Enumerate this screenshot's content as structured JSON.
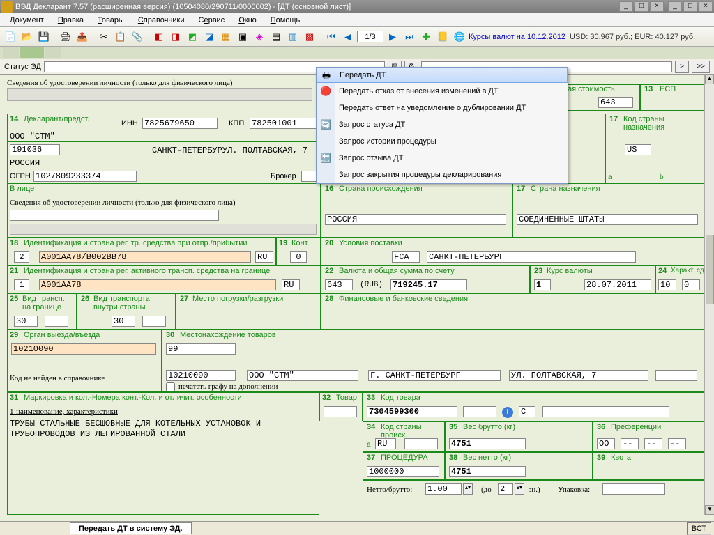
{
  "title": "ВЭД Декларант 7.57 (расширенная версия) (10504080/290711/0000002) - [ДТ (основной лист)]",
  "menubar": [
    "Документ",
    "Правка",
    "Товары",
    "Справочники",
    "Сервис",
    "Окно",
    "Помощь"
  ],
  "toolbar": {
    "page": "1/3",
    "rates_link": "Курсы валют на 10.12.2012",
    "rates": "USD: 30.967 руб.; EUR: 40.127 руб."
  },
  "status_label": "Статус ЭД",
  "context_menu": [
    "Передать ДТ",
    "Передать отказ от внесения изменений в ДТ",
    "Передать ответ на уведомление о дублировании ДТ",
    "Запрос статуса ДТ",
    "Запрос истории процедуры",
    "Запрос отзыва ДТ",
    "Запрос закрытия процедуры декларирования"
  ],
  "f": {
    "top_cut": "Сведения об удостоверении личности (только для физического лица)",
    "box_cost": "ая стоимость",
    "b13": "13",
    "b13_l": "ЕСП",
    "b13_v": "643",
    "b14": "14",
    "b14_l": "Декларант/предст.",
    "inn_l": "ИНН",
    "inn_v": "7825679650",
    "kpp_l": "КПП",
    "kpp_v": "782501001",
    "b17": "17",
    "b17_l": "Код страны назначения",
    "b17_v": "US",
    "company": "ООО \"СТМ\"",
    "zip": "191036",
    "addr": "САНКТ-ПЕТЕРБУРУЛ. ПОЛТАВСКАЯ, 7",
    "country": "РОССИЯ",
    "ogrn_l": "ОГРН",
    "ogrn_v": "1027809233374",
    "broker_l": "Брокер",
    "vlice": "В лице",
    "id_note": "Сведения об удостоверении личности (только для физического лица)",
    "b16": "16",
    "b16_l": "Страна происхождения",
    "b16_v": "РОССИЯ",
    "b17a": "17",
    "b17a_l": "Страна назначения",
    "b17a_v": "СОЕДИНЕННЫЕ ШТАТЫ",
    "sml_a": "а",
    "sml_b": "b",
    "b18": "18",
    "b18_l": "Идентификация и страна рег. тр. средства при отпр./прибытии",
    "b18_n": "2",
    "b18_id": "A001AA78/B002BB78",
    "b18_c": "RU",
    "b19": "19",
    "b19_l": "Конт.",
    "b19_v": "0",
    "b20": "20",
    "b20_l": "Условия поставки",
    "b20_c": "FCA",
    "b20_v": "САНКТ-ПЕТЕРБУРГ",
    "b21": "21",
    "b21_l": "Идентификация и страна рег. активного трансп. средства на границе",
    "b21_n": "1",
    "b21_id": "A001AA78",
    "b21_c": "RU",
    "b22": "22",
    "b22_l": "Валюта и общая сумма по счету",
    "b22_c": "643",
    "b22_cur": "(RUB)",
    "b22_v": "719245.17",
    "b23": "23",
    "b23_l": "Курс валюты",
    "b23_v": "1",
    "b23_d": "28.07.2011",
    "b24": "24",
    "b24_l": "Характ. сд.",
    "b24_a": "10",
    "b24_b": "0",
    "b25": "25",
    "b25_l": "Вид трансп. на границе",
    "b25_v": "30",
    "b26": "26",
    "b26_l": "Вид транспорта внутри страны",
    "b26_v": "30",
    "b27": "27",
    "b27_l": "Место погрузки/разгрузки",
    "b28": "28",
    "b28_l": "Финансовые и банковские сведения",
    "b29": "29",
    "b29_l": "Орган выезда/въезда",
    "b29_v": "10210090",
    "b29_note": "Код не найден в справочнике",
    "b30": "30",
    "b30_l": "Местонахождение товаров",
    "b30_v": "99",
    "b30_code": "10210090",
    "b30_org": "ООО \"СТМ\"",
    "b30_city": "Г. САНКТ-ПЕТЕРБУРГ",
    "b30_street": "УЛ. ПОЛТАВСКАЯ, 7",
    "b30_chk": "печатать графу на дополнении",
    "b31": "31",
    "b31_l": "Маркировка и кол.-Номера конт.-Кол. и отличит. особенности",
    "b31_sub": "1-наименование, характеристики",
    "b31_txt": "ТРУБЫ СТАЛЬНЫЕ БЕСШОВНЫЕ ДЛЯ КОТЕЛЬНЫХ УСТАНОВОК И ТРУБОПРОВОДОВ ИЗ ЛЕГИРОВАННОЙ СТАЛИ",
    "b32": "32",
    "b32_l": "Товар",
    "b33": "33",
    "b33_l": "Код товара",
    "b33_v": "7304599300",
    "b33_c": "С",
    "b34": "34",
    "b34_l": "Код страны происх.",
    "b34_v": "RU",
    "b35": "35",
    "b35_l": "Вес брутто (кг)",
    "b35_v": "4751",
    "b36": "36",
    "b36_l": "Преференции",
    "b36_v1": "ОО",
    "b36_v2": "--",
    "b36_v3": "--",
    "b36_v4": "--",
    "b37": "37",
    "b37_l": "ПРОЦЕДУРА",
    "b37_v": "1000000",
    "b38": "38",
    "b38_l": "Вес нетто (кг)",
    "b38_v": "4751",
    "b39": "39",
    "b39_l": "Квота",
    "nb_l": "Нетто/брутто:",
    "nb_v": "1.00",
    "do_l": "(до",
    "do_v": "2",
    "zn_l": "зн.)",
    "pack_l": "Упаковка:"
  },
  "bottom": {
    "tab": "Передать ДТ в систему ЭД.",
    "mode": "ВСТ"
  }
}
